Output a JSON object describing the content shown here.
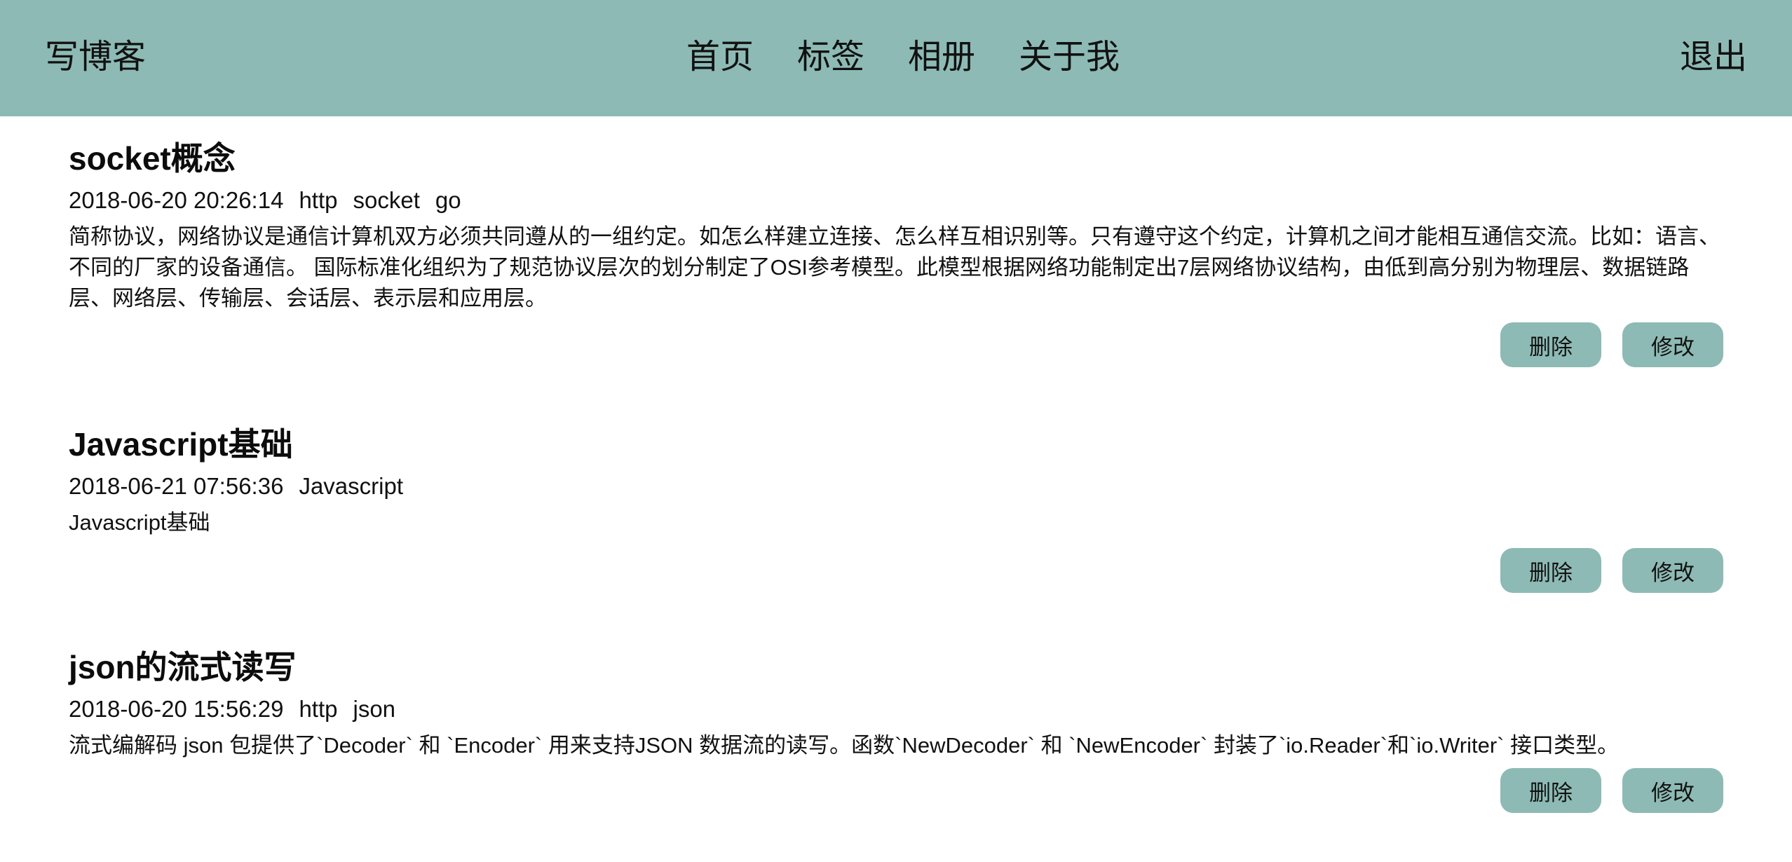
{
  "header": {
    "brand": "写博客",
    "nav": [
      "首页",
      "标签",
      "相册",
      "关于我"
    ],
    "logout": "退出"
  },
  "posts": [
    {
      "title": "socket概念",
      "date": "2018-06-20 20:26:14",
      "tags": [
        "http",
        "socket",
        "go"
      ],
      "excerpt": "简称协议，网络协议是通信计算机双方必须共同遵从的一组约定。如怎么样建立连接、怎么样互相识别等。只有遵守这个约定，计算机之间才能相互通信交流。比如：语言、不同的厂家的设备通信。 国际标准化组织为了规范协议层次的划分制定了OSI参考模型。此模型根据网络功能制定出7层网络协议结构，由低到高分别为物理层、数据链路层、网络层、传输层、会话层、表示层和应用层。",
      "delete_label": "删除",
      "edit_label": "修改"
    },
    {
      "title": "Javascript基础",
      "date": "2018-06-21 07:56:36",
      "tags": [
        "Javascript"
      ],
      "excerpt": "Javascript基础",
      "delete_label": "删除",
      "edit_label": "修改"
    },
    {
      "title": "json的流式读写",
      "date": "2018-06-20 15:56:29",
      "tags": [
        "http",
        "json"
      ],
      "excerpt": "流式编解码 json 包提供了`Decoder` 和 `Encoder` 用来支持JSON 数据流的读写。函数`NewDecoder` 和 `NewEncoder` 封装了`io.Reader`和`io.Writer` 接口类型。",
      "delete_label": "删除",
      "edit_label": "修改"
    }
  ]
}
